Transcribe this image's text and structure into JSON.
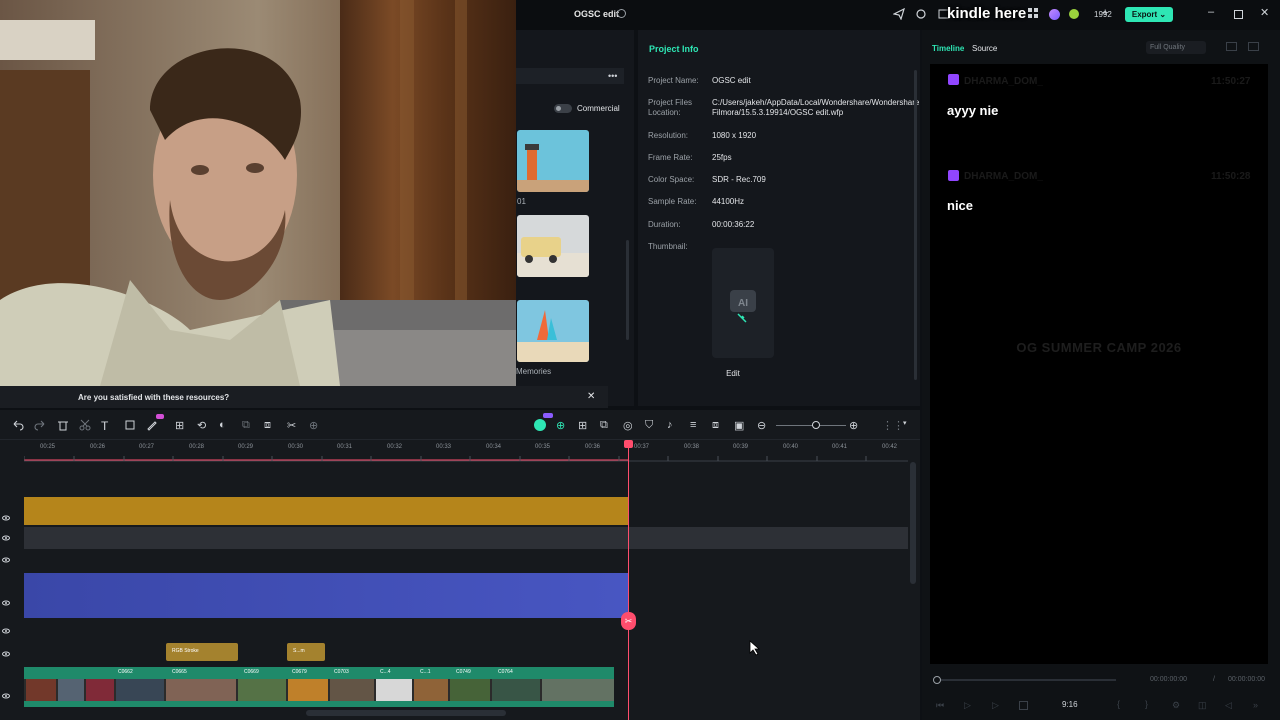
{
  "overlay_caption": {
    "line1": "...",
    "line2": "kindle here"
  },
  "topbar": {
    "project_title": "OGSC edit",
    "credits": "1992",
    "export_label": "Export"
  },
  "media": {
    "commercial_label": "Commercial",
    "items": [
      {
        "caption": "01"
      },
      {
        "caption": ""
      },
      {
        "caption": "Memories"
      }
    ],
    "feedback_prompt": "Are you satisfied with these resources?"
  },
  "project_info": {
    "heading": "Project Info",
    "rows": [
      {
        "key": "Project Name:",
        "value": "OGSC edit"
      },
      {
        "key": "Project Files Location:",
        "value": "C:/Users/jakeh/AppData/Local/Wondershare/Wondershare Filmora/15.5.3.19914/OGSC edit.wfp"
      },
      {
        "key": "Resolution:",
        "value": "1080 x 1920"
      },
      {
        "key": "Frame Rate:",
        "value": "25fps"
      },
      {
        "key": "Color Space:",
        "value": "SDR - Rec.709"
      },
      {
        "key": "Sample Rate:",
        "value": "44100Hz"
      },
      {
        "key": "Duration:",
        "value": "00:00:36:22"
      },
      {
        "key": "Thumbnail:",
        "value": ""
      }
    ],
    "edit_label": "Edit"
  },
  "player": {
    "tab_timeline": "Timeline",
    "tab_source": "Source",
    "quality": "Full Quality",
    "chat": [
      {
        "user": "DHARMA_DOM_",
        "time": "11:50:27",
        "message": "ayyy nie"
      },
      {
        "user": "DHARMA_DOM_",
        "time": "11:50:28",
        "message": "nice"
      }
    ],
    "watermark": "OG SUMMER CAMP 2026",
    "time_current": "00:00:00:00",
    "time_total": "00:00:00:00",
    "aspect": "9:16"
  },
  "timeline": {
    "ruler": [
      "00:25",
      "00:26",
      "00:27",
      "00:28",
      "00:29",
      "00:30",
      "00:31",
      "00:32",
      "00:33",
      "00:34",
      "00:35",
      "00:36",
      "00:37",
      "00:38",
      "00:39",
      "00:40",
      "00:41",
      "00:42"
    ],
    "effects": [
      {
        "label": "RGB Stroke"
      },
      {
        "label": "S...m"
      }
    ],
    "video_clips": [
      {
        "label": ""
      },
      {
        "label": "C0662"
      },
      {
        "label": "C0665"
      },
      {
        "label": "C0669"
      },
      {
        "label": "C0679"
      },
      {
        "label": "C0703"
      },
      {
        "label": "C...4"
      },
      {
        "label": "C...1"
      },
      {
        "label": "C0749"
      },
      {
        "label": "C0764"
      }
    ]
  },
  "colors": {
    "accent": "#2ee6b4",
    "playhead": "#ff4d6d",
    "gold_track": "#b5851b",
    "blue_track": "#4452b8",
    "clip_green": "#1f8a6a"
  }
}
